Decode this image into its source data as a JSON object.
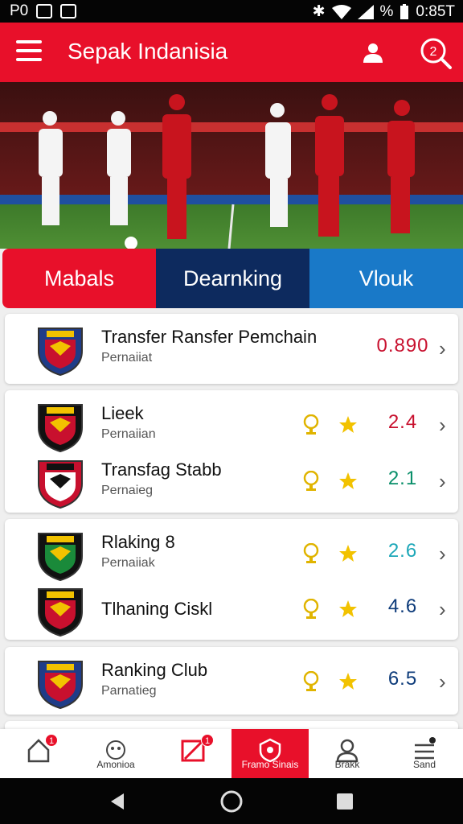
{
  "status_bar": {
    "carrier": "P0",
    "battery_percent": "%",
    "time": "0:85T"
  },
  "app_bar": {
    "title": "Sepak Indanisia",
    "search_badge": "2"
  },
  "tabs": [
    {
      "label": "Mabals"
    },
    {
      "label": "Dearnking"
    },
    {
      "label": "Vlouk"
    }
  ],
  "list": [
    {
      "name": "Transfer Ransfer Pemchain",
      "sub": "Pernaiiat",
      "value": "0.890",
      "value_color": "#c8102e",
      "has_trophy": false
    },
    {
      "name": "Lieek",
      "sub": "Pernaiian",
      "value": "2.4",
      "value_color": "#c8102e",
      "has_trophy": true
    },
    {
      "name": "Transfag Stabb",
      "sub": "Pernaieg",
      "value": "2.1",
      "value_color": "#0a8f6a",
      "has_trophy": true
    },
    {
      "name": "Rlaking 8",
      "sub": "Pernaiiak",
      "value": "2.6",
      "value_color": "#1ca7b8",
      "has_trophy": true
    },
    {
      "name": "Tlhaning Ciskl",
      "sub": "",
      "value": "4.6",
      "value_color": "#0d3b7a",
      "has_trophy": true
    },
    {
      "name": "Ranking Club",
      "sub": "Parnatieg",
      "value": "6.5",
      "value_color": "#0d3b7a",
      "has_trophy": true
    }
  ],
  "bottom_nav": [
    {
      "label": "",
      "icon": "home-icon",
      "badge": "1"
    },
    {
      "label": "Amonioa",
      "icon": "mascot-icon",
      "badge": ""
    },
    {
      "label": "",
      "icon": "edit-icon",
      "badge": "1"
    },
    {
      "label": "Framo Sinais",
      "icon": "shield-icon",
      "badge": ""
    },
    {
      "label": "Brakk",
      "icon": "profile-icon",
      "badge": ""
    },
    {
      "label": "Sand",
      "icon": "list-icon",
      "badge": ""
    }
  ],
  "colors": {
    "brand_red": "#e8102a",
    "navy": "#0d2a5e",
    "blue": "#1979c8",
    "star": "#f2c200",
    "trophy": "#e0b400"
  }
}
